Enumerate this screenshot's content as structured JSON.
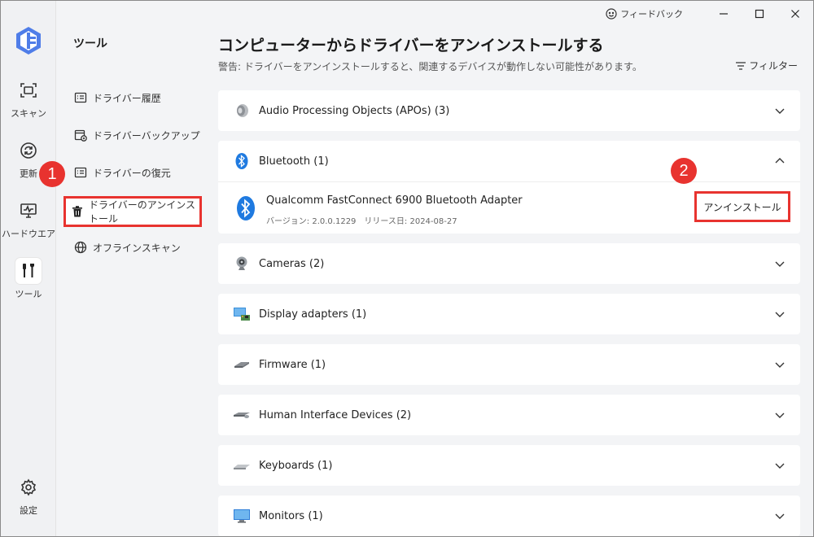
{
  "titlebar": {
    "feedback_label": "フィードバック"
  },
  "rail": {
    "items": [
      {
        "label": "スキャン",
        "icon": "scan-icon"
      },
      {
        "label": "更新",
        "icon": "update-icon"
      },
      {
        "label": "ハードウエア",
        "icon": "hardware-icon"
      },
      {
        "label": "ツール",
        "icon": "tools-icon"
      },
      {
        "label": "設定",
        "icon": "settings-icon"
      }
    ]
  },
  "subnav": {
    "title": "ツール",
    "items": [
      {
        "label": "ドライバー履歴",
        "icon": "history-icon"
      },
      {
        "label": "ドライバーバックアップ",
        "icon": "backup-icon"
      },
      {
        "label": "ドライバーの復元",
        "icon": "restore-icon"
      },
      {
        "label": "ドライバーのアンインストール",
        "icon": "trash-icon"
      },
      {
        "label": "オフラインスキャン",
        "icon": "globe-icon"
      }
    ]
  },
  "main": {
    "title": "コンピューターからドライバーをアンインストールする",
    "warning": "警告: ドライバーをアンインストールすると、関連するデバイスが動作しない可能性があります。",
    "filter_label": "フィルター",
    "categories": [
      {
        "label": "Audio Processing Objects (APOs) (3)",
        "icon": "speaker-icon"
      },
      {
        "label": "Bluetooth (1)",
        "icon": "bluetooth-icon"
      },
      {
        "label": "Cameras (2)",
        "icon": "webcam-icon"
      },
      {
        "label": "Display adapters (1)",
        "icon": "display-adapter-icon"
      },
      {
        "label": "Firmware (1)",
        "icon": "firmware-icon"
      },
      {
        "label": "Human Interface Devices (2)",
        "icon": "hid-icon"
      },
      {
        "label": "Keyboards (1)",
        "icon": "keyboard-icon"
      },
      {
        "label": "Monitors (1)",
        "icon": "monitor-icon"
      }
    ],
    "device": {
      "name": "Qualcomm FastConnect 6900 Bluetooth Adapter",
      "meta": "バージョン: 2.0.0.1229　リリース日: 2024-08-27",
      "uninstall_label": "アンインストール"
    }
  },
  "annotations": {
    "badge1": "1",
    "badge2": "2"
  },
  "colors": {
    "accent": "#1a73e8",
    "highlight": "#e8332f"
  }
}
